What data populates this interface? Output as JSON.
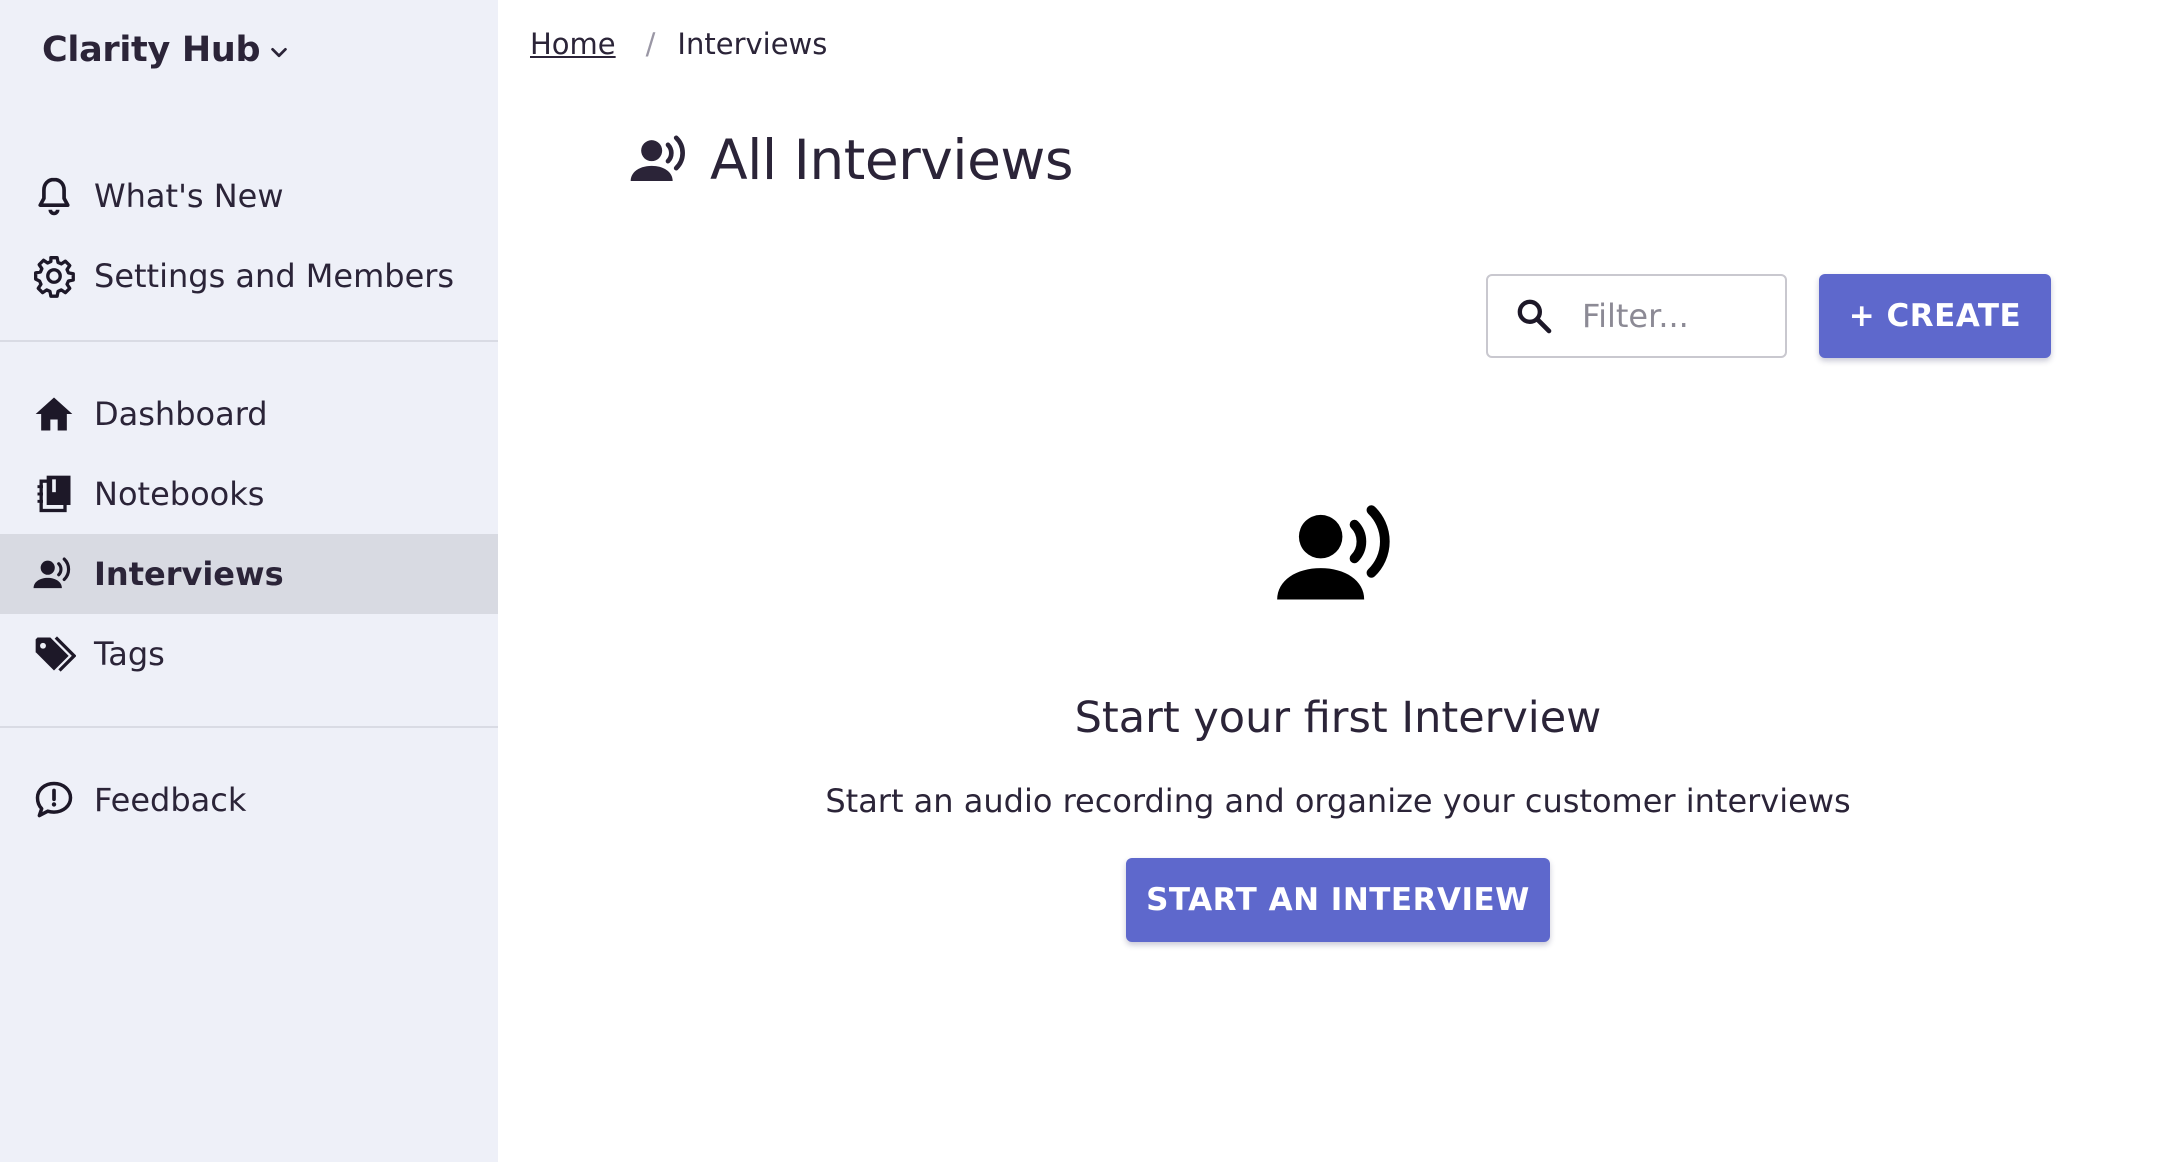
{
  "sidebar": {
    "workspace": "Clarity Hub",
    "top_items": [
      {
        "label": "What's New",
        "icon": "bell-icon"
      },
      {
        "label": "Settings and Members",
        "icon": "gear-icon"
      }
    ],
    "main_items": [
      {
        "label": "Dashboard",
        "icon": "home-icon"
      },
      {
        "label": "Notebooks",
        "icon": "notebooks-icon"
      },
      {
        "label": "Interviews",
        "icon": "interview-icon",
        "active": true
      },
      {
        "label": "Tags",
        "icon": "tags-icon"
      }
    ],
    "bottom_items": [
      {
        "label": "Feedback",
        "icon": "feedback-icon"
      }
    ]
  },
  "breadcrumb": {
    "home": "Home",
    "separator": "/",
    "current": "Interviews"
  },
  "page": {
    "title": "All Interviews"
  },
  "toolbar": {
    "filter_placeholder": "Filter...",
    "create_label": "+ CREATE"
  },
  "empty_state": {
    "title": "Start your first Interview",
    "subtitle": "Start an audio recording and organize your customer interviews",
    "button_label": "START AN INTERVIEW"
  },
  "colors": {
    "accent": "#5e68cc",
    "sidebar_bg": "#eef0f8",
    "active_bg": "#d8dae2",
    "text": "#2b2438"
  }
}
